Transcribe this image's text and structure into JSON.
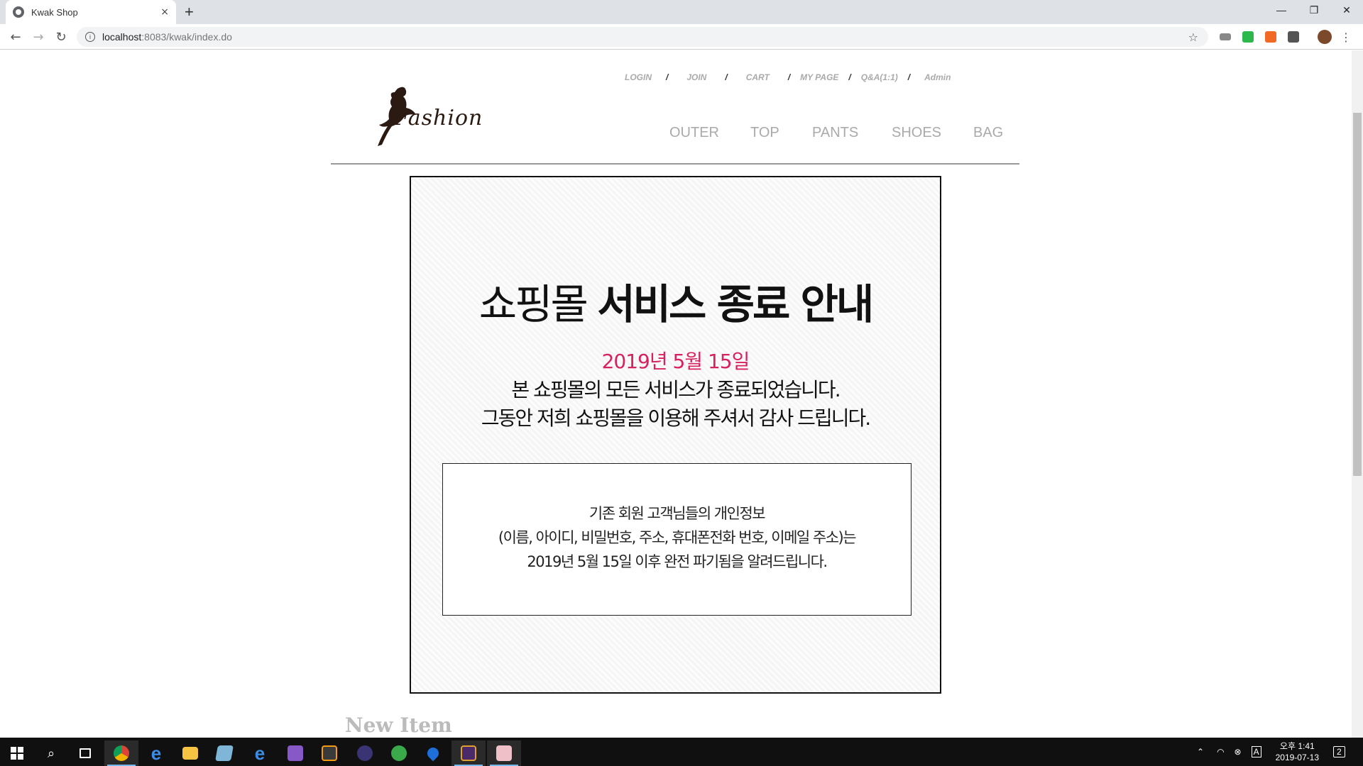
{
  "browser": {
    "tab_title": "Kwak Shop",
    "tab_close": "×",
    "new_tab": "+",
    "url_host": "localhost",
    "url_rest": ":8083/kwak/index.do",
    "win_minimize": "—",
    "win_restore": "❐",
    "win_close": "✕"
  },
  "site": {
    "top_links": [
      "LOGIN",
      "JOIN",
      "CART",
      "MY PAGE",
      "Q&A(1:1)",
      "Admin"
    ],
    "separator": "/",
    "logo_text": "Fashion",
    "categories": [
      "OUTER",
      "TOP",
      "PANTS",
      "SHOES",
      "BAG"
    ]
  },
  "notice": {
    "title_light": "쇼핑몰",
    "title_bold": "서비스 종료 안내",
    "date": "2019년 5월 15일",
    "line1": "본 쇼핑몰의 모든 서비스가 종료되었습니다.",
    "line2": "그동안 저희 쇼핑몰을 이용해 주셔서 감사 드립니다.",
    "box_line1": "기존 회원 고객님들의 개인정보",
    "box_line2": "(이름, 아이디, 비밀번호, 주소, 휴대폰전화 번호, 이메일 주소)는",
    "box_line3": "2019년 5월 15일 이후 완전 파기됨을 알려드립니다."
  },
  "section_heading": "New Item",
  "taskbar": {
    "clock_line1": "오후 1:41",
    "clock_line2": "2019-07-13",
    "ime": "A",
    "notification_count": "2"
  },
  "colors": {
    "accent_date": "#d6225f",
    "nav_gray": "#aaaaaa"
  }
}
